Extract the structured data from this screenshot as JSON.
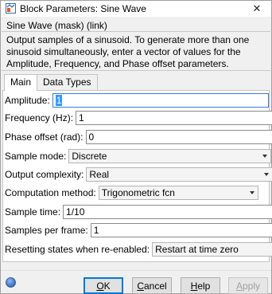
{
  "window": {
    "title": "Block Parameters: Sine Wave",
    "close_glyph": "✕"
  },
  "mask": {
    "title": "Sine Wave (mask) (link)",
    "description": "Output samples of a sinusoid.  To generate more than one sinusoid simultaneously, enter a vector of values for the Amplitude, Frequency, and Phase offset parameters."
  },
  "tabs": [
    {
      "label": "Main",
      "active": true
    },
    {
      "label": "Data Types",
      "active": false
    }
  ],
  "params": {
    "amplitude": {
      "label": "Amplitude:",
      "value": "1"
    },
    "frequency": {
      "label": "Frequency (Hz):",
      "value": "1"
    },
    "phase": {
      "label": "Phase offset (rad):",
      "value": "0"
    },
    "sample_mode": {
      "label": "Sample mode:",
      "value": "Discrete"
    },
    "output_complexity": {
      "label": "Output complexity:",
      "value": "Real"
    },
    "computation_method": {
      "label": "Computation method:",
      "value": "Trigonometric fcn"
    },
    "sample_time": {
      "label": "Sample time:",
      "value": "1/10"
    },
    "samples_per_frame": {
      "label": "Samples per frame:",
      "value": "1"
    },
    "resetting_states": {
      "label": "Resetting states when re-enabled:",
      "value": "Restart at time zero"
    }
  },
  "buttons": {
    "ok": {
      "mnemonic": "O",
      "rest": "K"
    },
    "cancel": {
      "mnemonic": "C",
      "rest": "ancel"
    },
    "help": {
      "mnemonic": "H",
      "rest": "elp"
    },
    "apply": {
      "mnemonic": "A",
      "rest": "pply"
    }
  },
  "icons": {
    "app": "simulink-block-icon",
    "help": "help-circle-icon"
  },
  "colors": {
    "accent": "#0078d7",
    "selection": "#3399ff",
    "focus_border": "#3b7ad9"
  }
}
